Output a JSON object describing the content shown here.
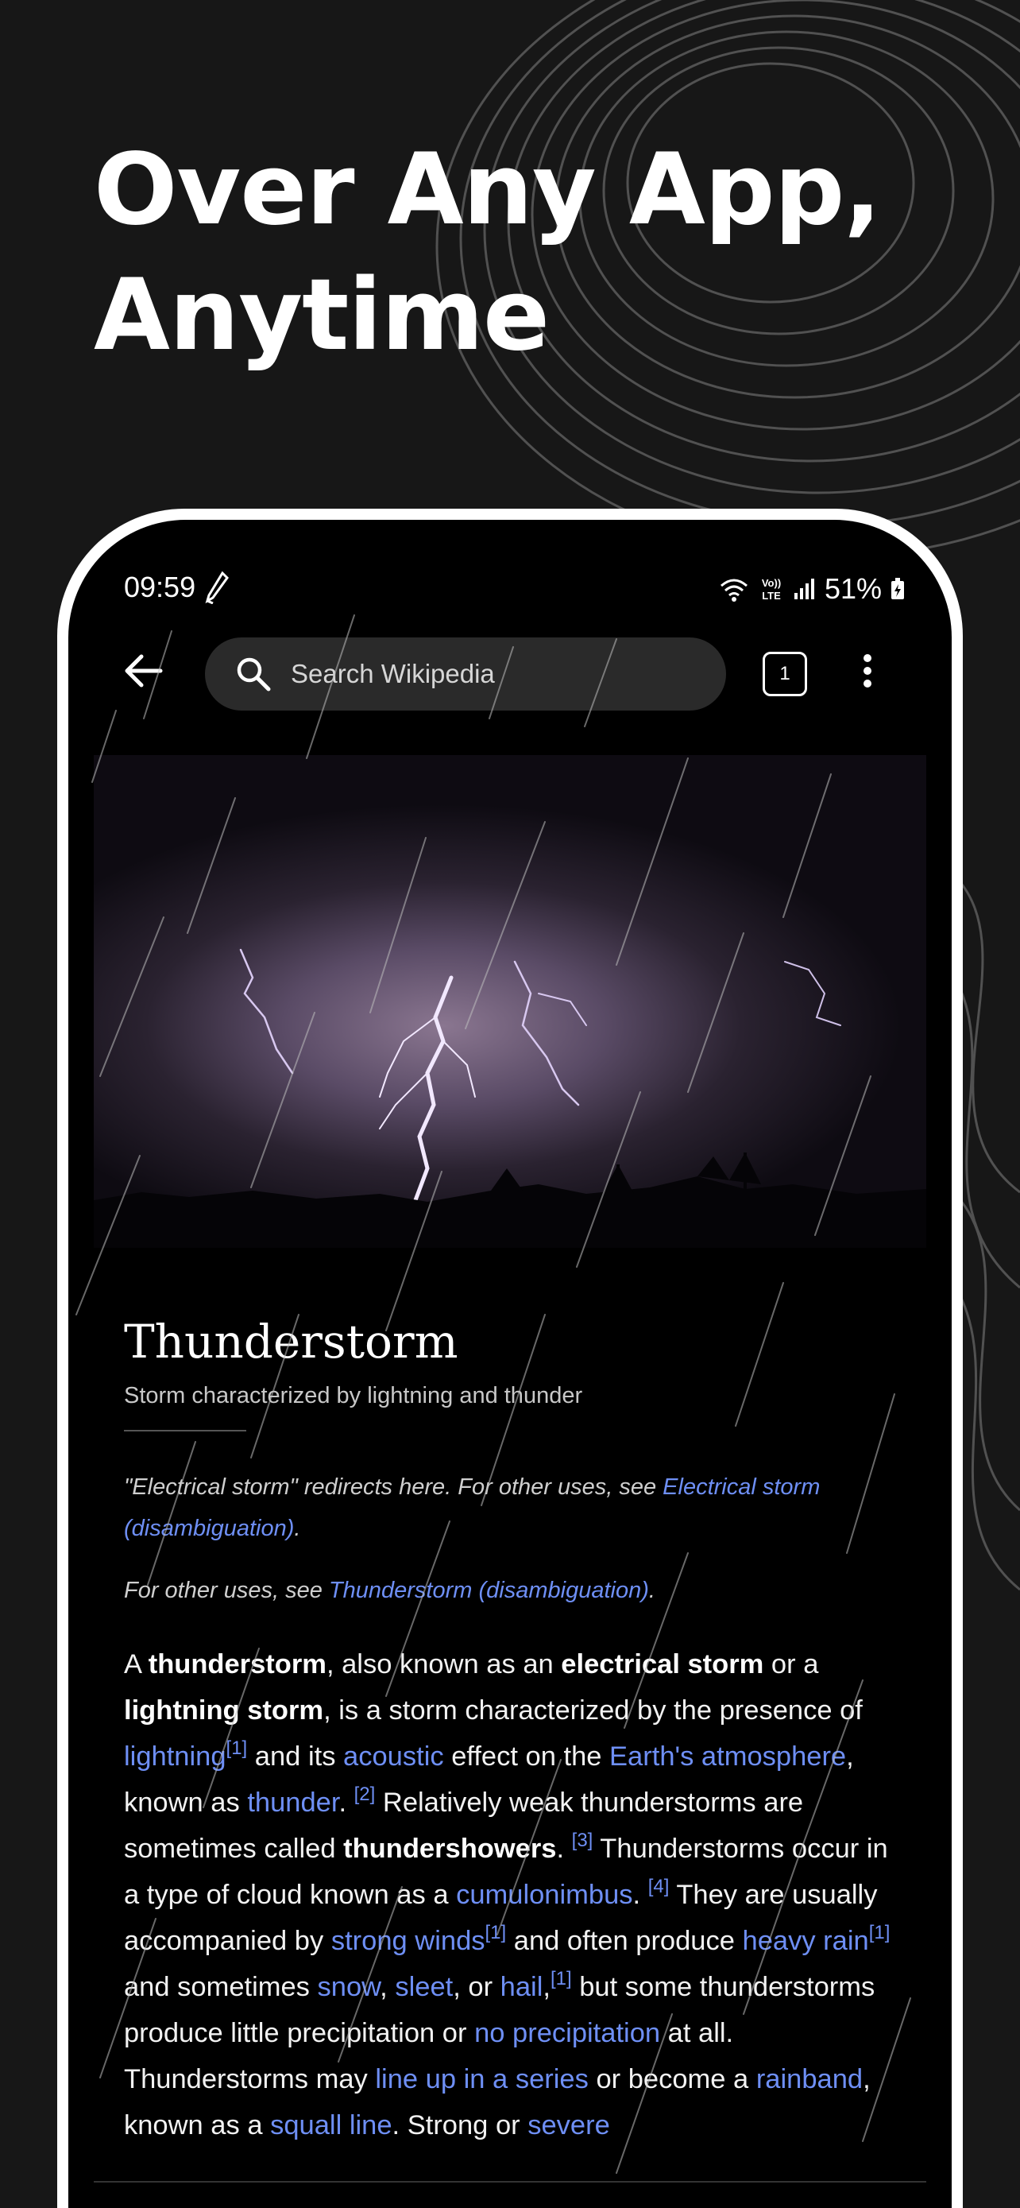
{
  "headline": {
    "line1": "Over Any App,",
    "line2": "Anytime"
  },
  "status_bar": {
    "time": "09:59",
    "network": "VoLTE",
    "battery": "51%"
  },
  "toolbar": {
    "search_placeholder": "Search Wikipedia",
    "tab_count": "1"
  },
  "article": {
    "title": "Thunderstorm",
    "description": "Storm characterized by lightning and thunder",
    "hatnote1_text": "\"Electrical storm\" redirects here. For other uses, see ",
    "hatnote1_link": "Electrical storm (disambiguation)",
    "hatnote2_text": "For other uses, see ",
    "hatnote2_link": "Thunderstorm (disambiguation)",
    "t_a": "A ",
    "b_thunderstorm": "thunderstorm",
    "t_also": ", also known as an ",
    "b_electrical": "electrical storm",
    "t_ora": " or a ",
    "b_lightning": "lightning storm",
    "t_is": ", is a storm characterized by the presence of ",
    "l_lightning": "lightning",
    "ref1": "[1]",
    "ref2": "[2]",
    "ref3": "[3]",
    "ref4": "[4]",
    "t_andits": " and its ",
    "l_acoustic": "acoustic",
    "t_effect": " effect on the ",
    "l_earth": "Earth's atmosphere",
    "t_known": ", known as ",
    "l_thunder": "thunder",
    "t_rel": " Relatively weak thunderstorms are sometimes called ",
    "b_showers": "thundershowers",
    "t_occur": " Thunderstorms occur in a type of cloud known as a ",
    "l_cumulo": "cumulonimbus",
    "t_usually": " They are usually accompanied by ",
    "l_winds": "strong winds",
    "t_often": " and often produce ",
    "l_heavyrain": "heavy rain",
    "t_sometimes": " and sometimes ",
    "l_snow": "snow",
    "l_sleet": "sleet",
    "t_or": ", or ",
    "l_hail": "hail",
    "t_butsome": " but some thunderstorms produce little precipitation or ",
    "l_noprecip": "no precipitation",
    "t_atall": " at all. Thunderstorms may ",
    "l_lineup": "line up in a series",
    "t_become": " or become a ",
    "l_rainband": "rainband",
    "t_knownas": ", known as a ",
    "l_squall": "squall line",
    "t_strong": ". Strong or ",
    "l_severe": "severe"
  }
}
